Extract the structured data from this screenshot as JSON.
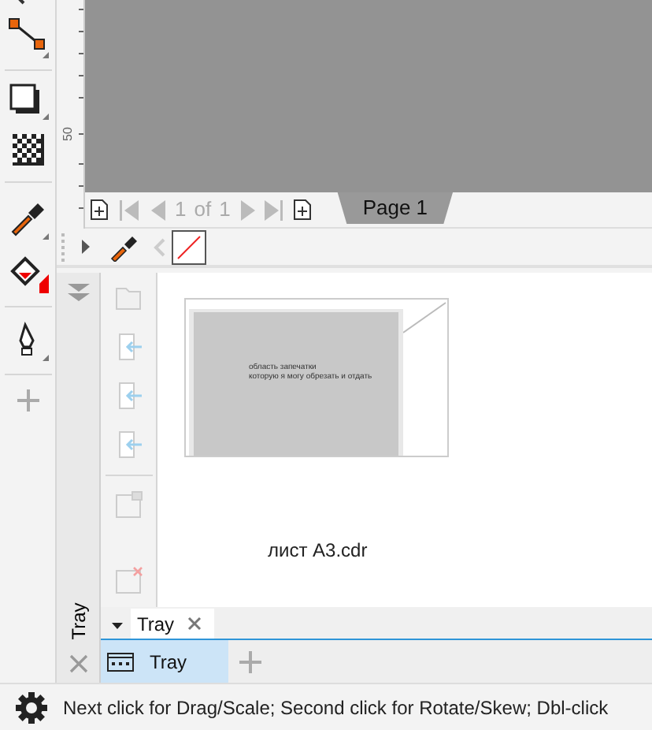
{
  "ruler": {
    "label": "50"
  },
  "pager": {
    "current": "1",
    "of": "of",
    "total": "1"
  },
  "page_tabs": [
    {
      "label": "Page 1",
      "selected": true
    }
  ],
  "thumbnail": {
    "lines": [
      "область запечатки",
      "которую я могу обрезать и отдать"
    ]
  },
  "file_name": "лист A3.cdr",
  "docker": {
    "side_label": "Tray",
    "tabs": [
      {
        "label": "Tray",
        "selected": true
      }
    ]
  },
  "bottom_tabs": [
    {
      "label": "Tray",
      "selected": true
    }
  ],
  "status_bar": {
    "text": "Next click for Drag/Scale; Second click for Rotate/Skew; Dbl-click"
  }
}
